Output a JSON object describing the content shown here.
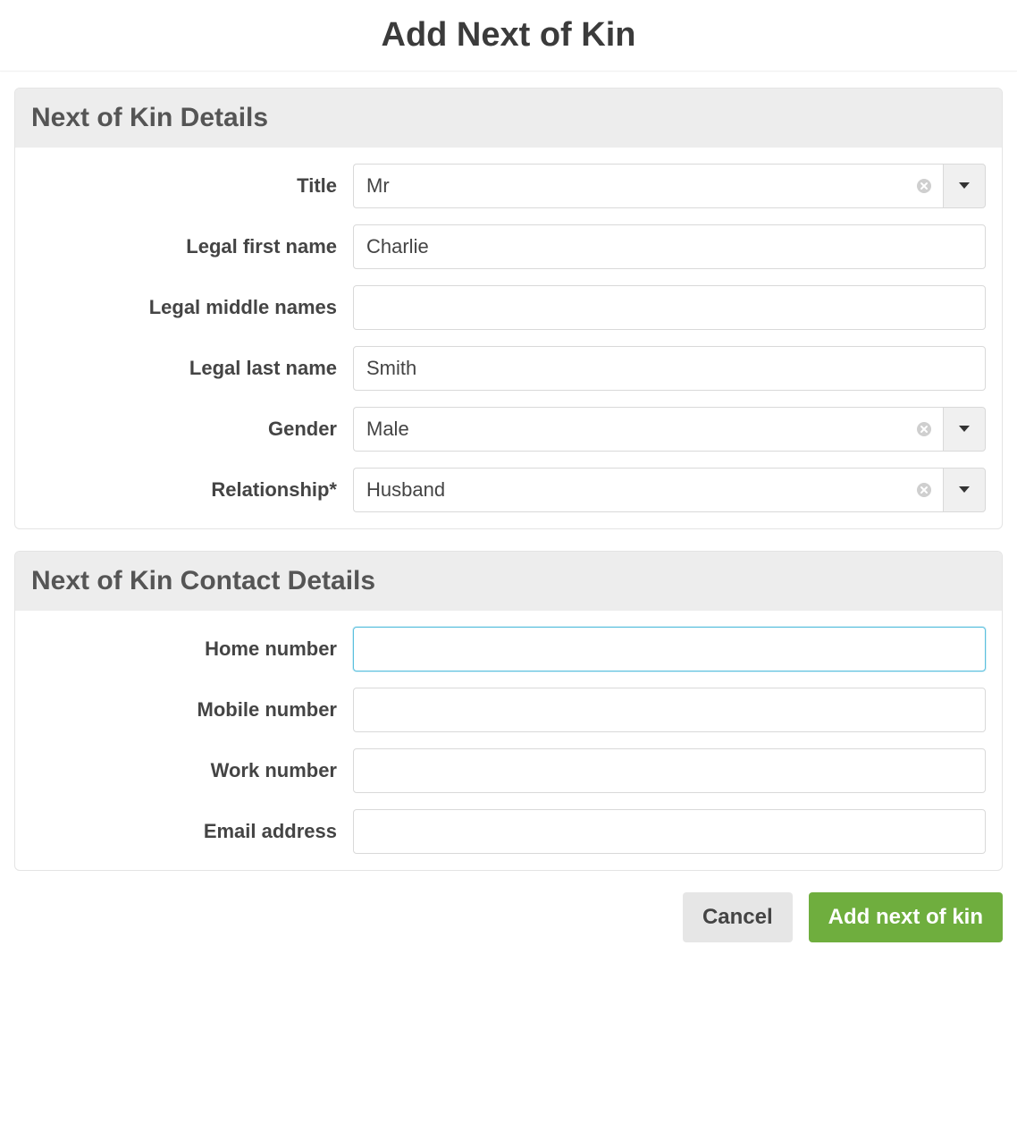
{
  "page": {
    "title": "Add Next of Kin"
  },
  "panels": {
    "details": {
      "heading": "Next of Kin Details",
      "fields": {
        "title_label": "Title",
        "title_value": "Mr",
        "first_name_label": "Legal first name",
        "first_name_value": "Charlie",
        "middle_names_label": "Legal middle names",
        "middle_names_value": "",
        "last_name_label": "Legal last name",
        "last_name_value": "Smith",
        "gender_label": "Gender",
        "gender_value": "Male",
        "relationship_label": "Relationship*",
        "relationship_value": "Husband"
      }
    },
    "contact": {
      "heading": "Next of Kin Contact Details",
      "fields": {
        "home_label": "Home number",
        "home_value": "",
        "mobile_label": "Mobile number",
        "mobile_value": "",
        "work_label": "Work number",
        "work_value": "",
        "email_label": "Email address",
        "email_value": ""
      }
    }
  },
  "buttons": {
    "cancel": "Cancel",
    "submit": "Add next of kin"
  },
  "colors": {
    "primary": "#6fae3e",
    "focus": "#5bc0de",
    "panel_header_bg": "#ededed"
  }
}
